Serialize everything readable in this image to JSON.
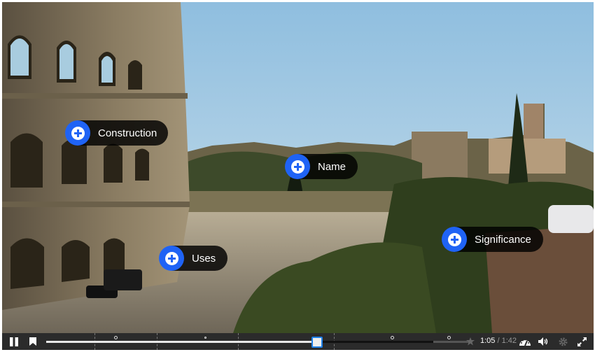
{
  "video": {
    "hotspots": [
      {
        "label": "Construction",
        "icon": "plus-circle-icon"
      },
      {
        "label": "Name",
        "icon": "plus-circle-icon"
      },
      {
        "label": "Uses",
        "icon": "plus-circle-icon"
      },
      {
        "label": "Significance",
        "icon": "plus-circle-icon"
      }
    ]
  },
  "controls": {
    "play_state": "playing",
    "current_time": "1:05",
    "separator": " / ",
    "duration": "1:42",
    "progress_percent": 63.7,
    "accent_color": "#1f63f5",
    "icons": [
      "pause-icon",
      "bookmark-icon",
      "star-icon",
      "playback-speed-icon",
      "volume-icon",
      "settings-icon",
      "fullscreen-icon"
    ]
  }
}
